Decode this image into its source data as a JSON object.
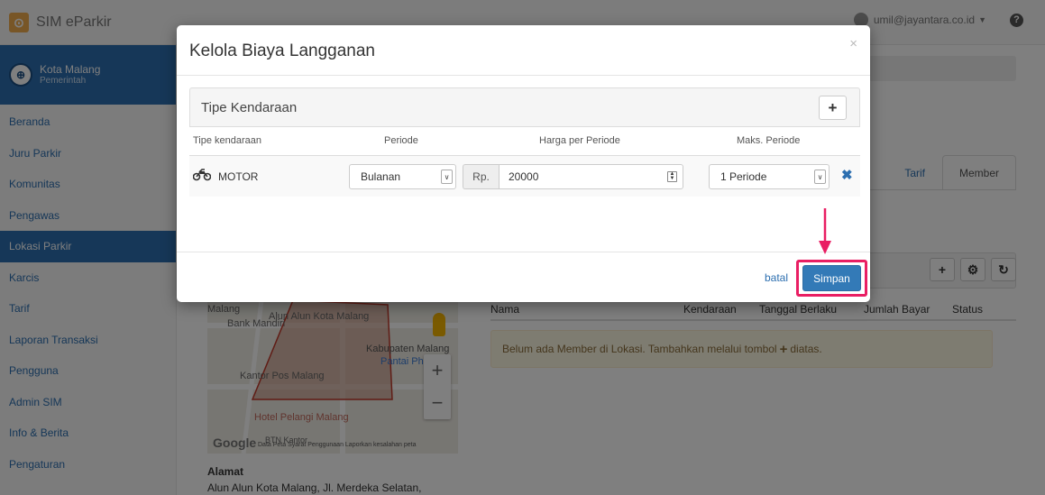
{
  "app": {
    "title": "SIM eParkir"
  },
  "user": {
    "email": "umil@jayantara.co.id"
  },
  "org": {
    "name": "Kota Malang",
    "sub": "Pemerintah"
  },
  "sidebar": {
    "items": [
      {
        "label": "Beranda"
      },
      {
        "label": "Juru Parkir"
      },
      {
        "label": "Komunitas"
      },
      {
        "label": "Pengawas"
      },
      {
        "label": "Lokasi Parkir",
        "active": true
      },
      {
        "label": "Karcis"
      },
      {
        "label": "Tarif"
      },
      {
        "label": "Laporan Transaksi"
      },
      {
        "label": "Pengguna"
      },
      {
        "label": "Admin SIM"
      },
      {
        "label": "Info & Berita"
      },
      {
        "label": "Pengaturan"
      }
    ]
  },
  "tabs": {
    "tarif": "Tarif",
    "member": "Member"
  },
  "map": {
    "labels": [
      "Malang",
      "Bank Mandiri",
      "Alun Alun Kota Malang",
      "Kabupaten Malang",
      "Pantai Photo",
      "Kantor Pos Malang",
      "Hotel Pelangi Malang",
      "BTN Kantor"
    ],
    "google": "Google",
    "footer": "Data Peta   Syarat Penggunaan   Laporkan kesalahan peta"
  },
  "alamat": {
    "title": "Alamat",
    "text": "Alun Alun Kota Malang, Jl. Merdeka Selatan,"
  },
  "member_table": {
    "headers": {
      "nama": "Nama",
      "kendaraan": "Kendaraan",
      "tanggal": "Tanggal Berlaku",
      "jumlah": "Jumlah Bayar",
      "status": "Status"
    },
    "empty_before": "Belum ada Member di Lokasi. Tambahkan melalui tombol",
    "empty_after": "diatas."
  },
  "modal": {
    "title": "Kelola Biaya Langganan",
    "panel_title": "Tipe Kendaraan",
    "columns": {
      "tipe": "Tipe kendaraan",
      "periode": "Periode",
      "harga": "Harga per Periode",
      "maks": "Maks. Periode"
    },
    "row": {
      "vehicle": "MOTOR",
      "periode": "Bulanan",
      "currency": "Rp.",
      "harga": "20000",
      "maks": "1 Periode"
    },
    "cancel_label": "batal",
    "save_label": "Simpan"
  },
  "colors": {
    "primary": "#337ab7",
    "highlight": "#e91e63",
    "sidebar_active": "#2d6fb0"
  }
}
